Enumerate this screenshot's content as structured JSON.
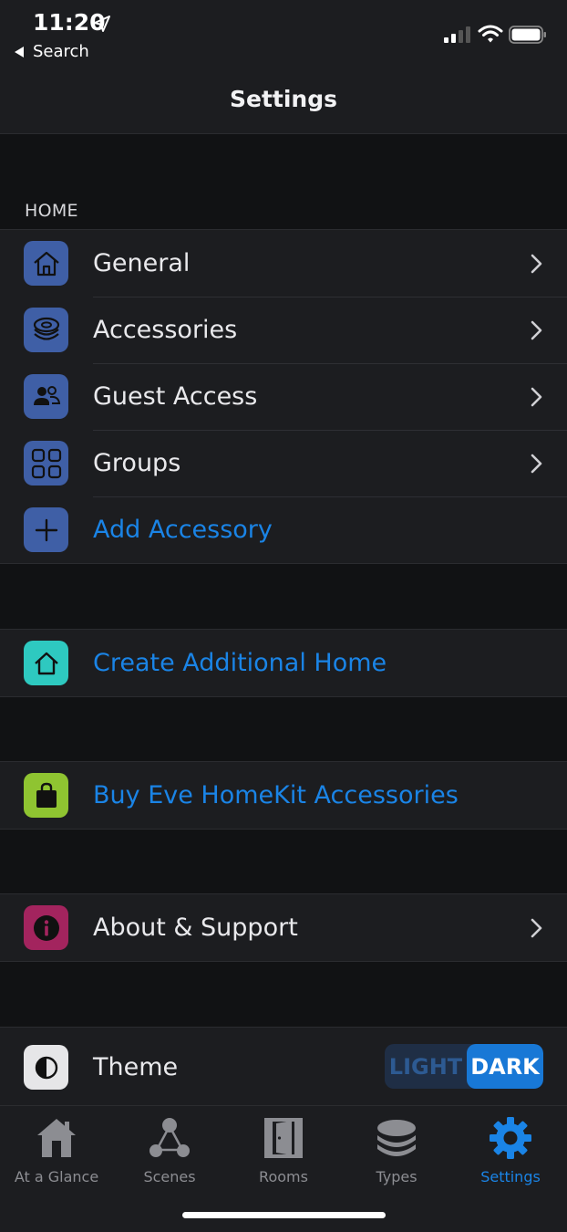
{
  "status_bar": {
    "time": "11:20",
    "back_label": "Search",
    "icons": [
      "location-arrow-icon",
      "signal-icon",
      "wifi-icon",
      "battery-icon"
    ]
  },
  "nav": {
    "title": "Settings"
  },
  "home_section": {
    "header": "HOME",
    "items": [
      {
        "label": "General",
        "icon": "house-icon",
        "color": "#3f5fa6"
      },
      {
        "label": "Accessories",
        "icon": "accessories-stack-icon",
        "color": "#3f5fa6"
      },
      {
        "label": "Guest Access",
        "icon": "guest-users-icon",
        "color": "#3f5fa6"
      },
      {
        "label": "Groups",
        "icon": "groups-grid-icon",
        "color": "#3f5fa6"
      },
      {
        "label": "Add Accessory",
        "icon": "plus-icon",
        "color": "#3f5fa6"
      }
    ]
  },
  "create_home": {
    "label": "Create Additional Home",
    "icon": "house-outline-icon",
    "color": "#2ec9c0"
  },
  "buy": {
    "label": "Buy Eve HomeKit Accessories",
    "icon": "shopping-bag-icon",
    "color": "#8fc431"
  },
  "about": {
    "label": "About & Support",
    "icon": "info-icon",
    "color": "#a3245e"
  },
  "theme": {
    "label": "Theme",
    "icon": "contrast-icon",
    "light_label": "LIGHT",
    "dark_label": "DARK",
    "selected": "DARK"
  },
  "tabs": [
    {
      "label": "At a Glance",
      "icon": "house-tab-icon"
    },
    {
      "label": "Scenes",
      "icon": "scenes-icon"
    },
    {
      "label": "Rooms",
      "icon": "door-icon"
    },
    {
      "label": "Types",
      "icon": "layers-icon"
    },
    {
      "label": "Settings",
      "icon": "gear-icon",
      "active": true
    }
  ],
  "colors": {
    "accent": "#1a84e6",
    "background": "#111214",
    "cell": "#1c1d20"
  }
}
